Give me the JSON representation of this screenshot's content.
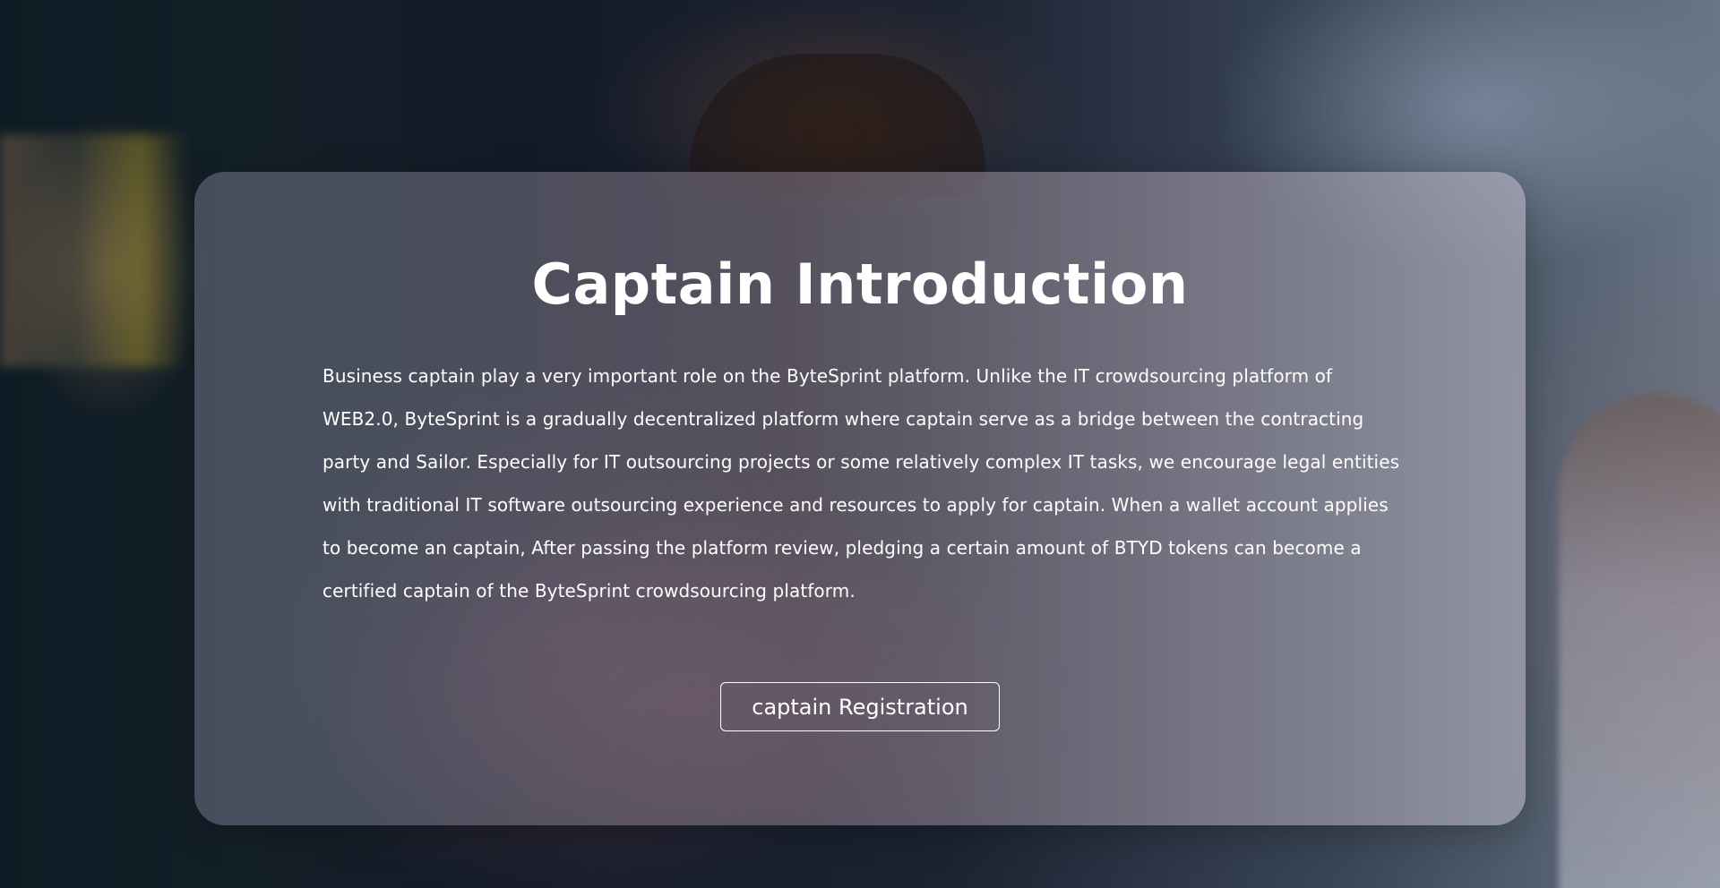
{
  "intro": {
    "title": "Captain Introduction",
    "paragraph": "Business captain play a very important role on the ByteSprint platform. Unlike the IT crowdsourcing platform of WEB2.0, ByteSprint is a gradually decentralized platform where captain serve as a bridge between the contracting party and Sailor. Especially for IT outsourcing projects or some relatively complex IT tasks, we encourage legal entities with traditional IT software outsourcing experience and resources to apply for captain. When a wallet account applies to become an captain, After passing the platform review, pledging a certain amount of BTYD tokens can become a certified captain of the ByteSprint crowdsourcing platform.",
    "button_label": "captain Registration"
  },
  "colors": {
    "text": "#ffffff",
    "button_border": "#ffffff"
  }
}
